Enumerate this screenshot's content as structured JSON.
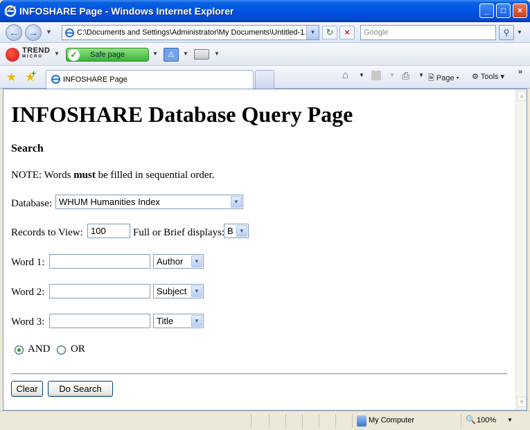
{
  "window": {
    "title": "INFOSHARE Page - Windows Internet Explorer",
    "min_glyph": "_",
    "max_glyph": "□",
    "close_glyph": "×"
  },
  "address_bar": {
    "url": "C:\\Documents and Settings\\Administrator\\My Documents\\Untitled-1.h",
    "search_placeholder": "Google"
  },
  "toolbar": {
    "trend_line1": "TREND",
    "trend_line2": "MICRO",
    "safe_label": "Safe page"
  },
  "tabs": {
    "active_label": "INFOSHARE Page"
  },
  "commands": {
    "page_label": "Page",
    "tools_label": "Tools"
  },
  "page": {
    "heading": "INFOSHARE Database Query Page",
    "subheading": "Search",
    "note_prefix": "NOTE: Words ",
    "note_bold": "must",
    "note_suffix": " be filled in sequential order.",
    "database_label": "Database:",
    "database_value": "WHUM Humanities Index",
    "records_label": "Records to View:",
    "records_value": "100",
    "display_label": "Full or Brief displays:",
    "display_value": "B",
    "word1_label": "Word 1:",
    "word1_value": "",
    "word1_field": "Author",
    "word2_label": "Word 2:",
    "word2_value": "",
    "word2_field": "Subject",
    "word3_label": "Word 3:",
    "word3_value": "",
    "word3_field": "Title",
    "and_label": "AND",
    "or_label": "OR",
    "selected_operator": "AND",
    "clear_label": "Clear",
    "search_label": "Do Search"
  },
  "status_bar": {
    "zone": "My Computer",
    "zoom": "100%"
  }
}
